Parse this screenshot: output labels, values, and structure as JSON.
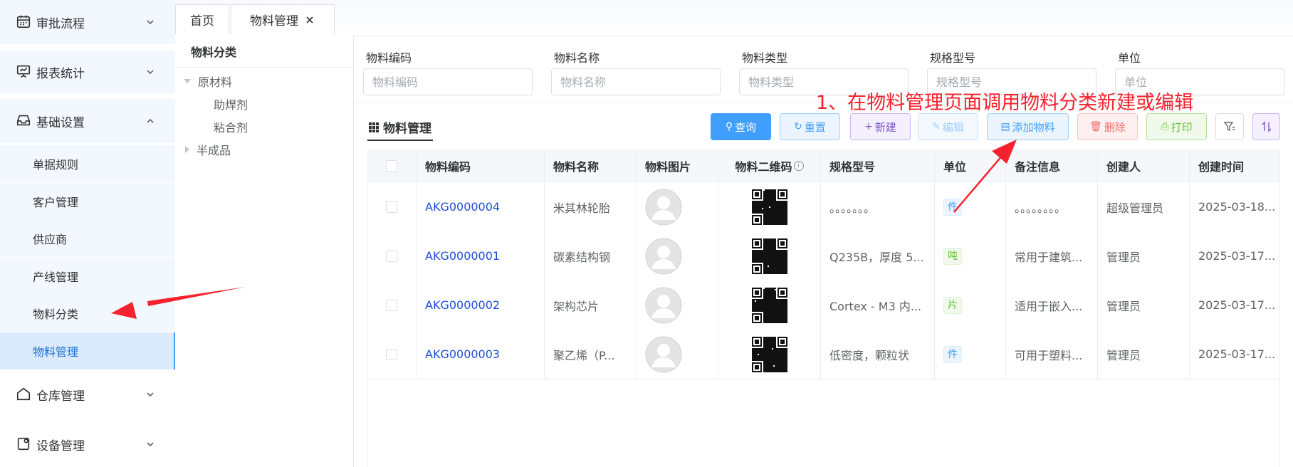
{
  "sidebar": {
    "groups": [
      {
        "label": "审批流程",
        "icon": "calendar-icon",
        "expanded": false
      },
      {
        "label": "报表统计",
        "icon": "chart-board-icon",
        "expanded": false
      },
      {
        "label": "基础设置",
        "icon": "inbox-icon",
        "expanded": true
      },
      {
        "label": "仓库管理",
        "icon": "house-icon",
        "expanded": false
      },
      {
        "label": "设备管理",
        "icon": "device-icon",
        "expanded": false
      }
    ],
    "sub_items": [
      "单据规则",
      "客户管理",
      "供应商",
      "产线管理",
      "物料分类",
      "物料管理"
    ],
    "active_sub_item": "物料管理"
  },
  "tabs": [
    {
      "label": "首页",
      "closable": false
    },
    {
      "label": "物料管理",
      "closable": true
    }
  ],
  "tree": {
    "title": "物料分类",
    "nodes": [
      {
        "label": "原材料",
        "expanded": true,
        "children": [
          "助焊剂",
          "粘合剂"
        ]
      },
      {
        "label": "半成品",
        "expanded": false
      }
    ]
  },
  "search": {
    "fields": [
      {
        "label": "物料编码",
        "placeholder": "物料编码"
      },
      {
        "label": "物料名称",
        "placeholder": "物料名称"
      },
      {
        "label": "物料类型",
        "placeholder": "物料类型"
      },
      {
        "label": "规格型号",
        "placeholder": "规格型号"
      },
      {
        "label": "单位",
        "placeholder": "单位"
      }
    ]
  },
  "card": {
    "title": "物料管理"
  },
  "toolbar": {
    "query": "查询",
    "reset": "重置",
    "create": "新建",
    "edit": "编辑",
    "add_material": "添加物料",
    "delete": "删除",
    "print": "打印"
  },
  "table": {
    "columns": [
      "物料编码",
      "物料名称",
      "物料图片",
      "物料二维码",
      "规格型号",
      "单位",
      "备注信息",
      "创建人",
      "创建时间"
    ],
    "rows": [
      {
        "code": "AKG0000004",
        "name": "米其林轮胎",
        "spec": "。。。。。。。",
        "unit": "件",
        "remark": "。。。。。。。。",
        "creator": "超级管理员",
        "created": "2025-03-18..."
      },
      {
        "code": "AKG0000001",
        "name": "碳素结构钢",
        "spec": "Q235B，厚度 5...",
        "unit": "吨",
        "remark": "常用于建筑...",
        "creator": "管理员",
        "created": "2025-03-17..."
      },
      {
        "code": "AKG0000002",
        "name": "架构芯片",
        "spec": "Cortex - M3 内...",
        "unit": "片",
        "remark": "适用于嵌入...",
        "creator": "管理员",
        "created": "2025-03-17..."
      },
      {
        "code": "AKG0000003",
        "name": "聚乙烯（P...",
        "spec": "低密度，颗粒状",
        "unit": "件",
        "remark": "可用于塑料...",
        "creator": "管理员",
        "created": "2025-03-17..."
      }
    ]
  },
  "annotation": {
    "text": "1、在物料管理页面调用物料分类新建或编辑"
  },
  "colors": {
    "primary": "#409eff",
    "link": "#1d4ed8",
    "danger": "#f56c6c",
    "success": "#67c23a",
    "annotation": "#f5222d",
    "tag_blue": "#409eff",
    "tag_green": "#67c23a"
  }
}
